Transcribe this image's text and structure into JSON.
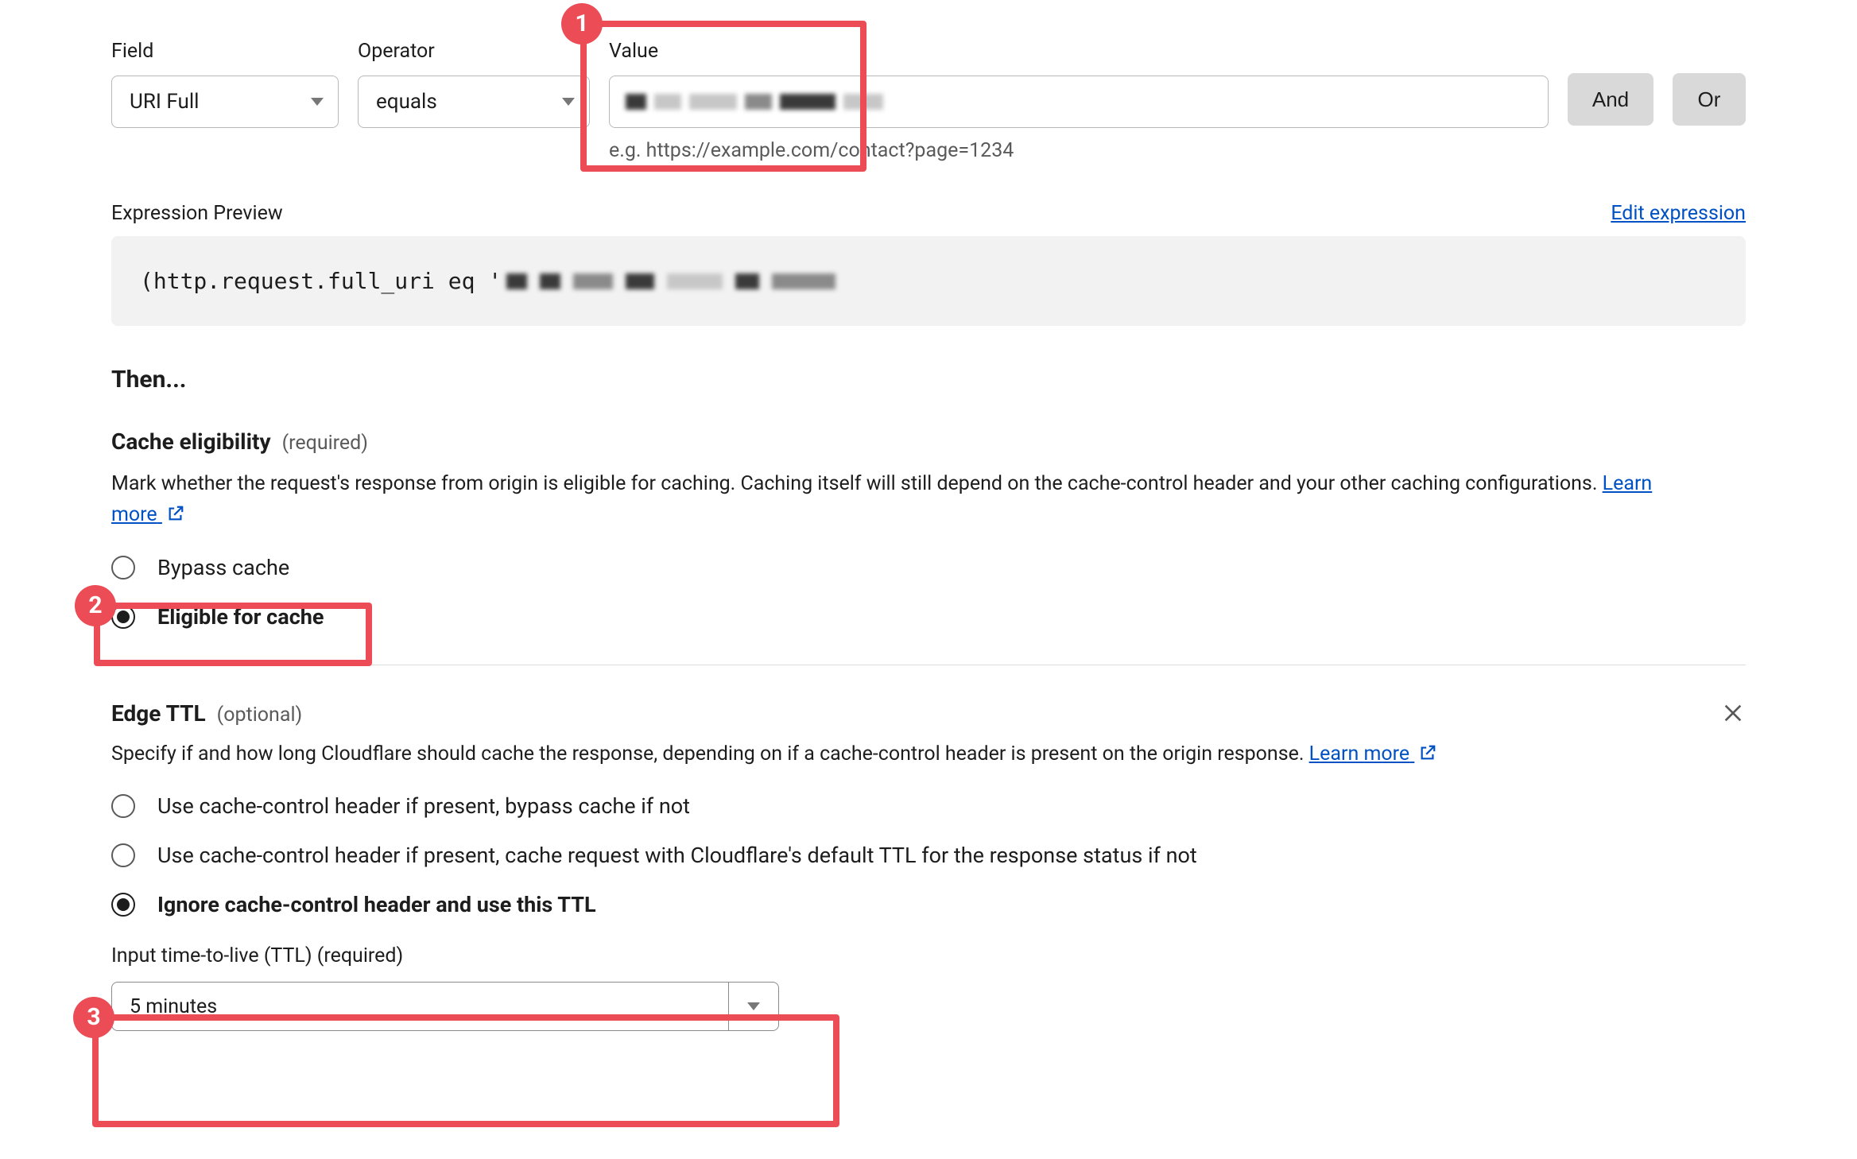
{
  "filter": {
    "field_label": "Field",
    "operator_label": "Operator",
    "value_label": "Value",
    "field_value": "URI Full",
    "operator_value": "equals",
    "value_value": "",
    "value_hint": "e.g. https://example.com/contact?page=1234",
    "and_label": "And",
    "or_label": "Or"
  },
  "preview": {
    "label": "Expression Preview",
    "edit_link": "Edit expression",
    "code_prefix": "(http.request.full_uri eq '"
  },
  "then_heading": "Then...",
  "cache": {
    "title": "Cache eligibility",
    "tag": "(required)",
    "desc_a": "Mark whether the request's response from origin is eligible for caching. Caching itself will still depend on the cache-control header and your other caching configurations. ",
    "learn_more": "Learn more",
    "opt_bypass": "Bypass cache",
    "opt_eligible": "Eligible for cache"
  },
  "edge": {
    "title": "Edge TTL",
    "tag": "(optional)",
    "desc_a": "Specify if and how long Cloudflare should cache the response, depending on if a cache-control header is present on the origin response. ",
    "learn_more": "Learn more",
    "opt1": "Use cache-control header if present, bypass cache if not",
    "opt2": "Use cache-control header if present, cache request with Cloudflare's default TTL for the response status if not",
    "opt3": "Ignore cache-control header and use this TTL",
    "ttl_label": "Input time-to-live (TTL) (required)",
    "ttl_value": "5 minutes"
  }
}
